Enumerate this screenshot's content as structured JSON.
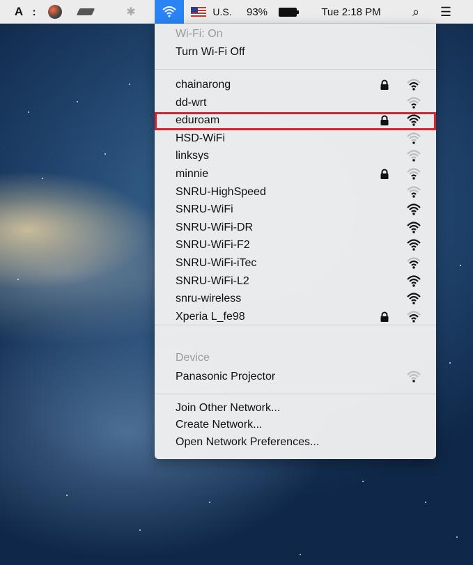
{
  "menubar": {
    "adobe": "A",
    "dots": ":",
    "bluetooth": "✱",
    "language": "U.S.",
    "battery": "93%",
    "time": "Tue 2:18 PM",
    "search": "⌕",
    "list": "☰"
  },
  "wifi_menu": {
    "status": "Wi-Fi: On",
    "toggle": "Turn Wi-Fi Off",
    "networks": [
      {
        "name": "chainarong",
        "locked": true,
        "strength": 3
      },
      {
        "name": "dd-wrt",
        "locked": false,
        "strength": 2
      },
      {
        "name": "eduroam",
        "locked": true,
        "strength": 4
      },
      {
        "name": "HSD-WiFi",
        "locked": false,
        "strength": 1
      },
      {
        "name": "linksys",
        "locked": false,
        "strength": 1
      },
      {
        "name": "minnie",
        "locked": true,
        "strength": 2
      },
      {
        "name": "SNRU-HighSpeed",
        "locked": false,
        "strength": 2
      },
      {
        "name": "SNRU-WiFi",
        "locked": false,
        "strength": 4
      },
      {
        "name": "SNRU-WiFi-DR",
        "locked": false,
        "strength": 4
      },
      {
        "name": "SNRU-WiFi-F2",
        "locked": false,
        "strength": 4
      },
      {
        "name": "SNRU-WiFi-iTec",
        "locked": false,
        "strength": 3
      },
      {
        "name": "SNRU-WiFi-L2",
        "locked": false,
        "strength": 4
      },
      {
        "name": "snru-wireless",
        "locked": false,
        "strength": 4
      },
      {
        "name": "Xperia L_fe98",
        "locked": true,
        "strength": 3
      }
    ],
    "device_header": "Device",
    "device": {
      "name": "Panasonic Projector",
      "strength": 1
    },
    "join_other": "Join Other Network...",
    "create_network": "Create Network...",
    "open_prefs": "Open Network Preferences..."
  },
  "colors": {
    "menubar_wifi_active": "#2a84f5",
    "highlight_box": "#e01e2b"
  }
}
